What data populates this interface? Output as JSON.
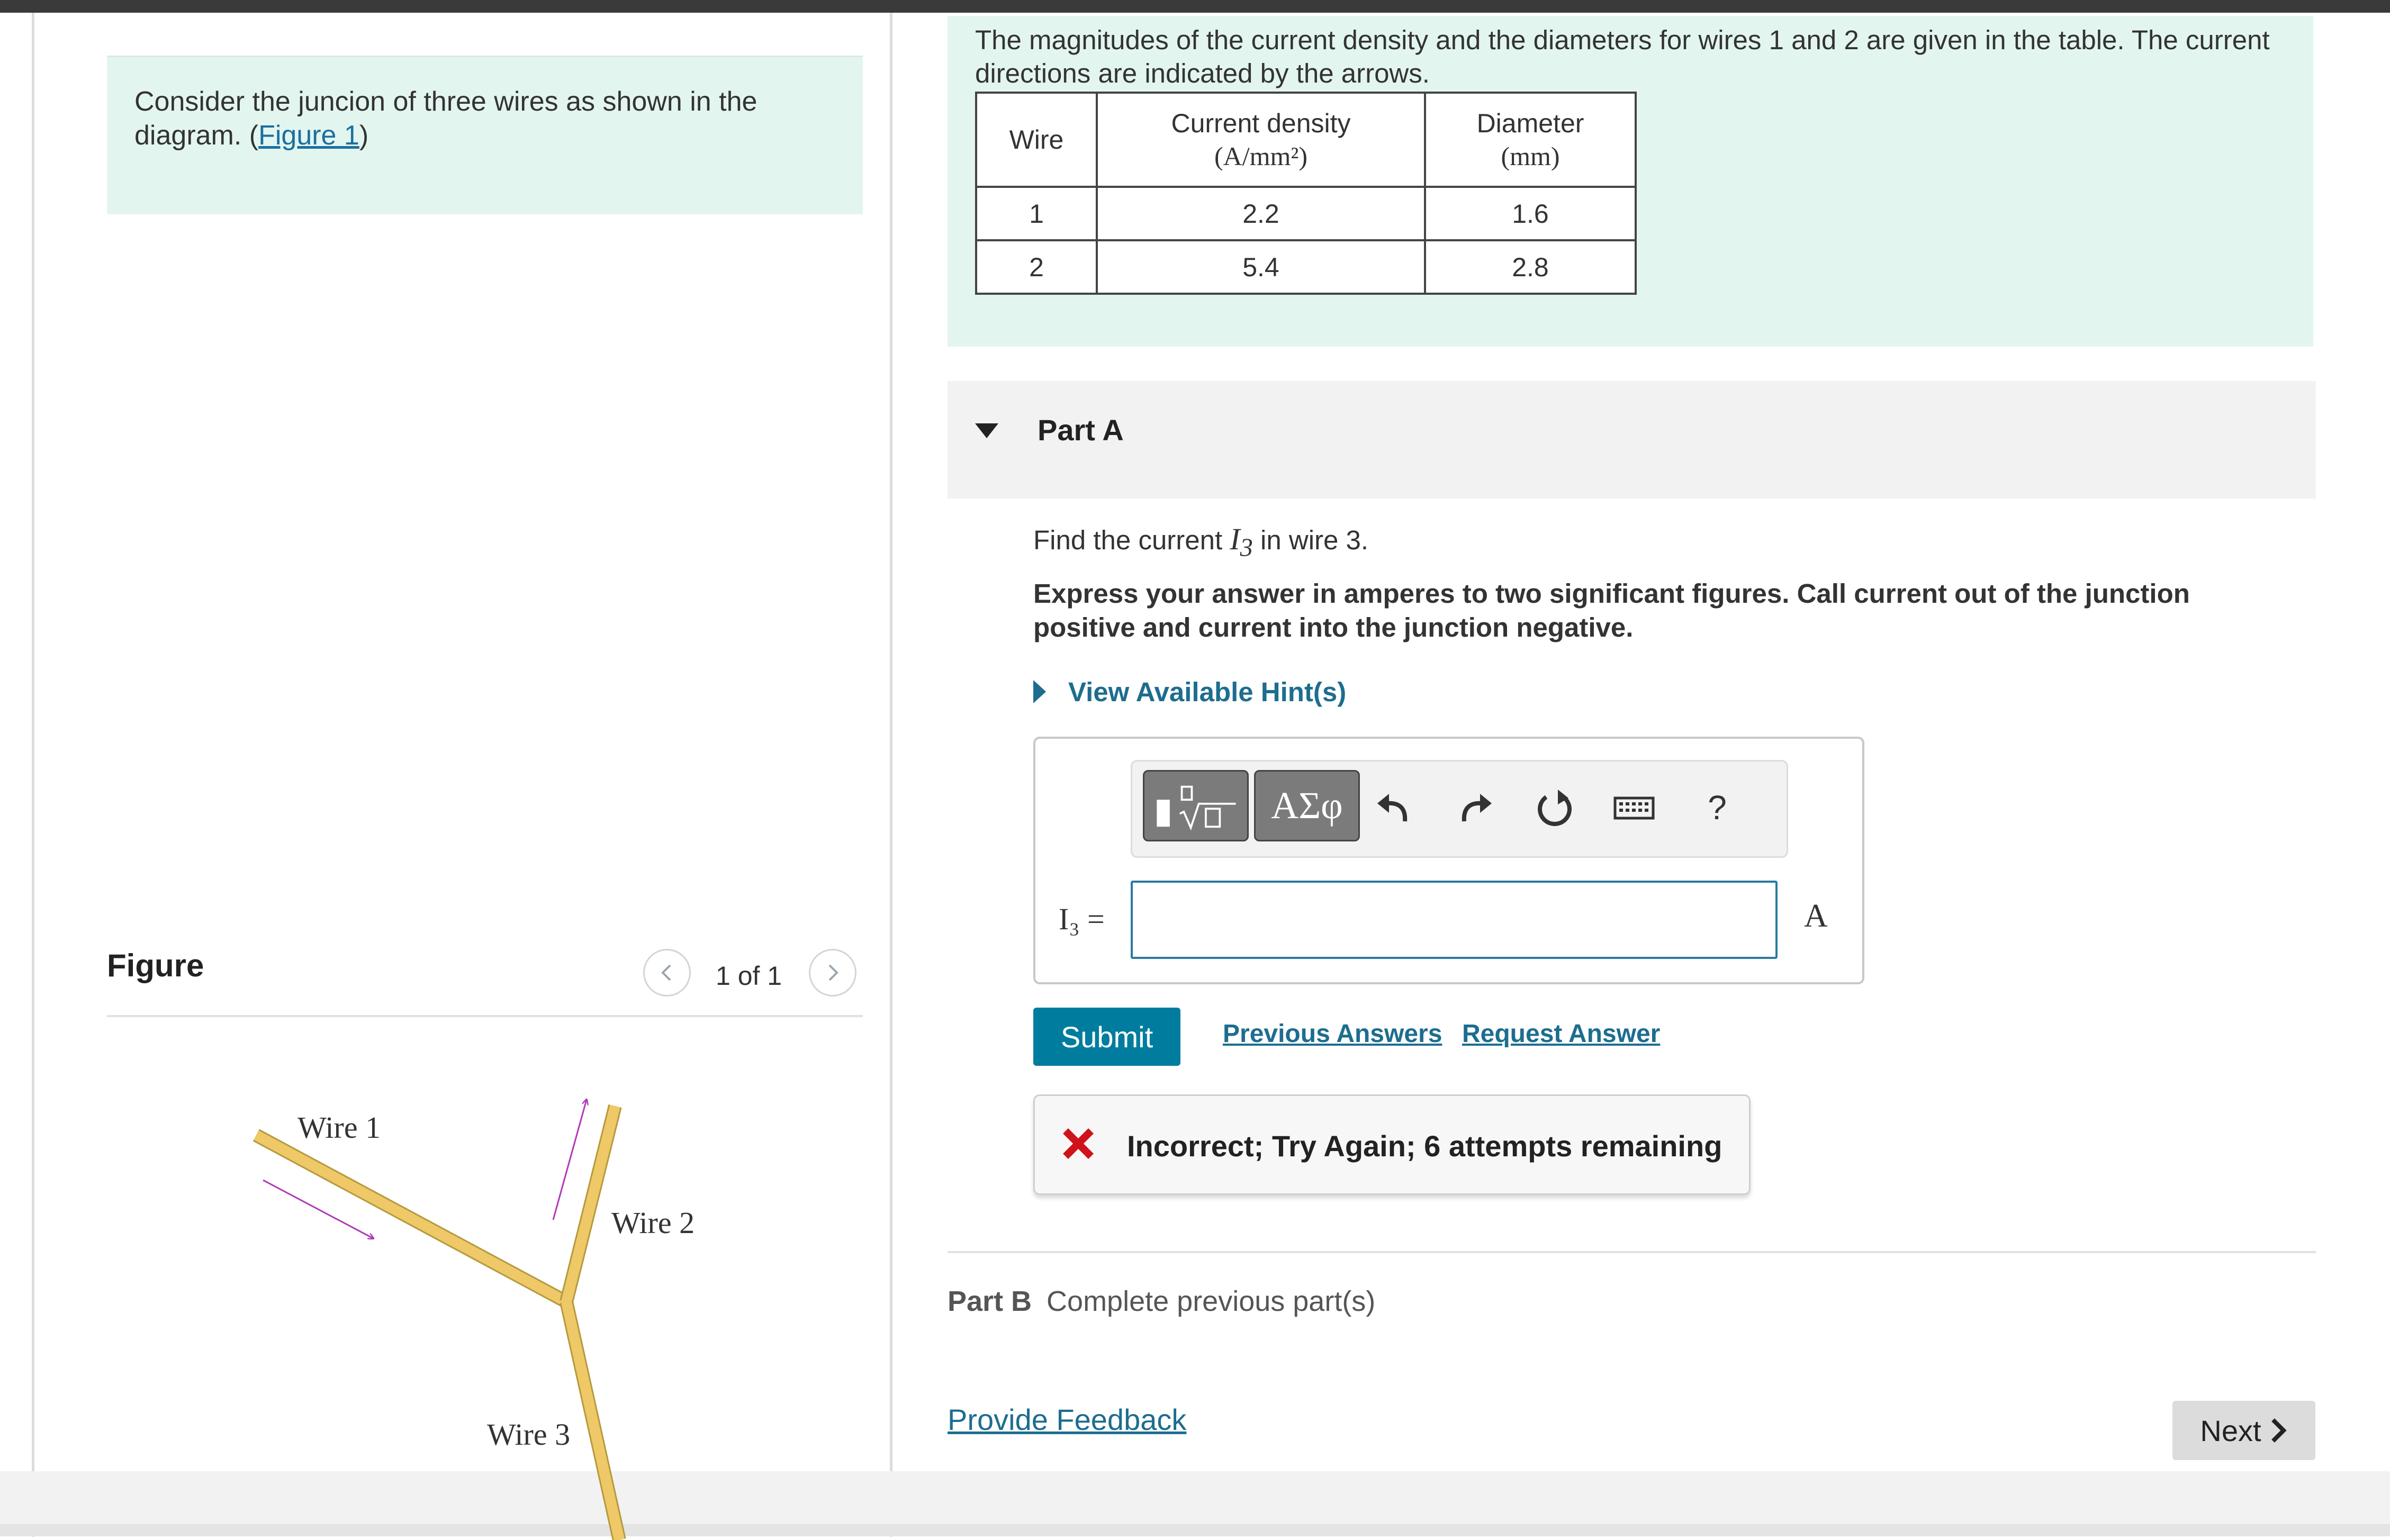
{
  "intro": {
    "text": "Consider the juncion of three wires as shown in the diagram. (",
    "link": "Figure 1",
    "suffix": ")"
  },
  "figure": {
    "title": "Figure",
    "counter": "1 of 1",
    "labels": {
      "wire1": "Wire 1",
      "wire2": "Wire 2",
      "wire3": "Wire 3"
    },
    "wire_color": "#efc867",
    "arrow_color": "#b03bb7"
  },
  "problem": {
    "text": "The magnitudes of the current density and the diameters for wires 1 and 2 are given in the table. The current directions are indicated by the arrows.",
    "table": {
      "headers": [
        {
          "line1": "Wire",
          "line2": ""
        },
        {
          "line1": "Current density",
          "line2": "(A/mm²)"
        },
        {
          "line1": "Diameter",
          "line2": "(mm)"
        }
      ],
      "rows": [
        {
          "wire": "1",
          "density": "2.2",
          "diameter": "1.6"
        },
        {
          "wire": "2",
          "density": "5.4",
          "diameter": "2.8"
        }
      ]
    }
  },
  "partA": {
    "title": "Part A",
    "question_prefix": "Find the current ",
    "question_var": "I",
    "question_sub": "3",
    "question_suffix": " in wire 3.",
    "instructions": "Express your answer in amperes to two significant figures. Call current out of the junction positive and current into the junction negative.",
    "hint_label": "View Available Hint(s)",
    "toolbar": {
      "greek": "ΑΣφ",
      "help": "?"
    },
    "var_label": "I₃ =",
    "answer_value": "",
    "unit": "A",
    "submit": "Submit",
    "previous_answers": "Previous Answers",
    "request_answer": "Request Answer",
    "feedback": "Incorrect; Try Again; 6 attempts remaining",
    "feedback_color": "#d0121b"
  },
  "partB": {
    "label": "Part B",
    "status": "Complete previous part(s)"
  },
  "footer": {
    "provide_feedback": "Provide Feedback",
    "next": "Next"
  },
  "colors": {
    "accent": "#007d9e",
    "link": "#1d6d8f",
    "panel_bg": "#e3f5ef"
  }
}
